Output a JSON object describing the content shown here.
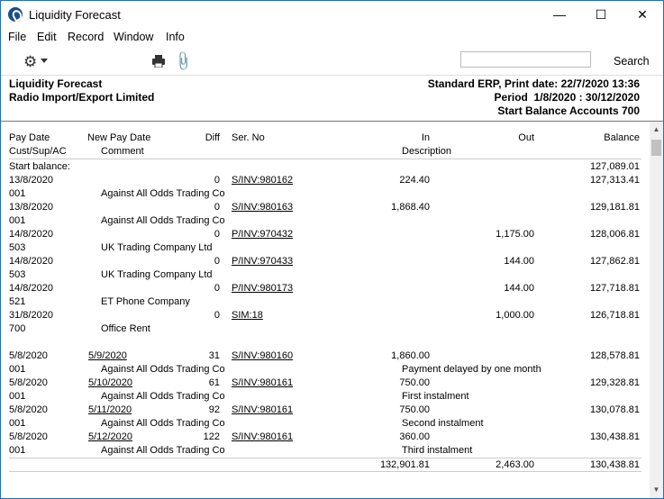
{
  "window": {
    "title": "Liquidity Forecast",
    "minimize": "—",
    "maximize": "☐",
    "close": "✕"
  },
  "menu": [
    "File",
    "Edit",
    "Record",
    "Window",
    "Info"
  ],
  "toolbar": {
    "search_value": "",
    "search_label": "Search"
  },
  "report": {
    "name": "Liquidity Forecast",
    "company": "Radio Import/Export Limited",
    "print_info": "Standard ERP, Print date: 22/7/2020 13:36",
    "period": "Period  1/8/2020 : 30/12/2020",
    "start_balance": "Start Balance Accounts 700"
  },
  "columns": {
    "pay_date": "Pay Date",
    "new_pay_date": "New Pay Date",
    "diff": "Diff",
    "ser_no": "Ser. No",
    "in": "In",
    "out": "Out",
    "balance": "Balance",
    "cust": "Cust/Sup/AC",
    "comment": "Comment",
    "description": "Description"
  },
  "start_row": {
    "label": "Start balance:",
    "balance": "127,089.01"
  },
  "rows": [
    {
      "pay_date": "13/8/2020",
      "new_pay_date": "",
      "diff": "0",
      "ser_no": "S/INV:980162",
      "in": "224.40",
      "out": "",
      "balance": "127,313.41",
      "cust": "001",
      "comment": "Against All Odds Trading Co",
      "description": ""
    },
    {
      "pay_date": "13/8/2020",
      "new_pay_date": "",
      "diff": "0",
      "ser_no": "S/INV:980163",
      "in": "1,868.40",
      "out": "",
      "balance": "129,181.81",
      "cust": "001",
      "comment": "Against All Odds Trading Co",
      "description": ""
    },
    {
      "pay_date": "14/8/2020",
      "new_pay_date": "",
      "diff": "0",
      "ser_no": "P/INV:970432",
      "in": "",
      "out": "1,175.00",
      "balance": "128,006.81",
      "cust": "503",
      "comment": "UK Trading Company Ltd",
      "description": ""
    },
    {
      "pay_date": "14/8/2020",
      "new_pay_date": "",
      "diff": "0",
      "ser_no": "P/INV:970433",
      "in": "",
      "out": "144.00",
      "balance": "127,862.81",
      "cust": "503",
      "comment": "UK Trading Company Ltd",
      "description": ""
    },
    {
      "pay_date": "14/8/2020",
      "new_pay_date": "",
      "diff": "0",
      "ser_no": "P/INV:980173",
      "in": "",
      "out": "144.00",
      "balance": "127,718.81",
      "cust": "521",
      "comment": "ET Phone Company",
      "description": ""
    },
    {
      "pay_date": "31/8/2020",
      "new_pay_date": "",
      "diff": "0",
      "ser_no": "SIM:18",
      "in": "",
      "out": "1,000.00",
      "balance": "126,718.81",
      "cust": "700",
      "comment": "Office Rent",
      "description": ""
    },
    {
      "pay_date": "5/8/2020",
      "new_pay_date": "5/9/2020",
      "diff": "31",
      "ser_no": "S/INV:980160",
      "in": "1,860.00",
      "out": "",
      "balance": "128,578.81",
      "cust": "001",
      "comment": "Against All Odds Trading Co",
      "description": "Payment delayed by one month"
    },
    {
      "pay_date": "5/8/2020",
      "new_pay_date": "5/10/2020",
      "diff": "61",
      "ser_no": "S/INV:980161",
      "in": "750.00",
      "out": "",
      "balance": "129,328.81",
      "cust": "001",
      "comment": "Against All Odds Trading Co",
      "description": "First instalment"
    },
    {
      "pay_date": "5/8/2020",
      "new_pay_date": "5/11/2020",
      "diff": "92",
      "ser_no": "S/INV:980161",
      "in": "750.00",
      "out": "",
      "balance": "130,078.81",
      "cust": "001",
      "comment": "Against All Odds Trading Co",
      "description": "Second instalment"
    },
    {
      "pay_date": "5/8/2020",
      "new_pay_date": "5/12/2020",
      "diff": "122",
      "ser_no": "S/INV:980161",
      "in": "360.00",
      "out": "",
      "balance": "130,438.81",
      "cust": "001",
      "comment": "Against All Odds Trading Co",
      "description": "Third instalment"
    }
  ],
  "totals": {
    "in": "132,901.81",
    "out": "2,463.00",
    "balance": "130,438.81"
  }
}
